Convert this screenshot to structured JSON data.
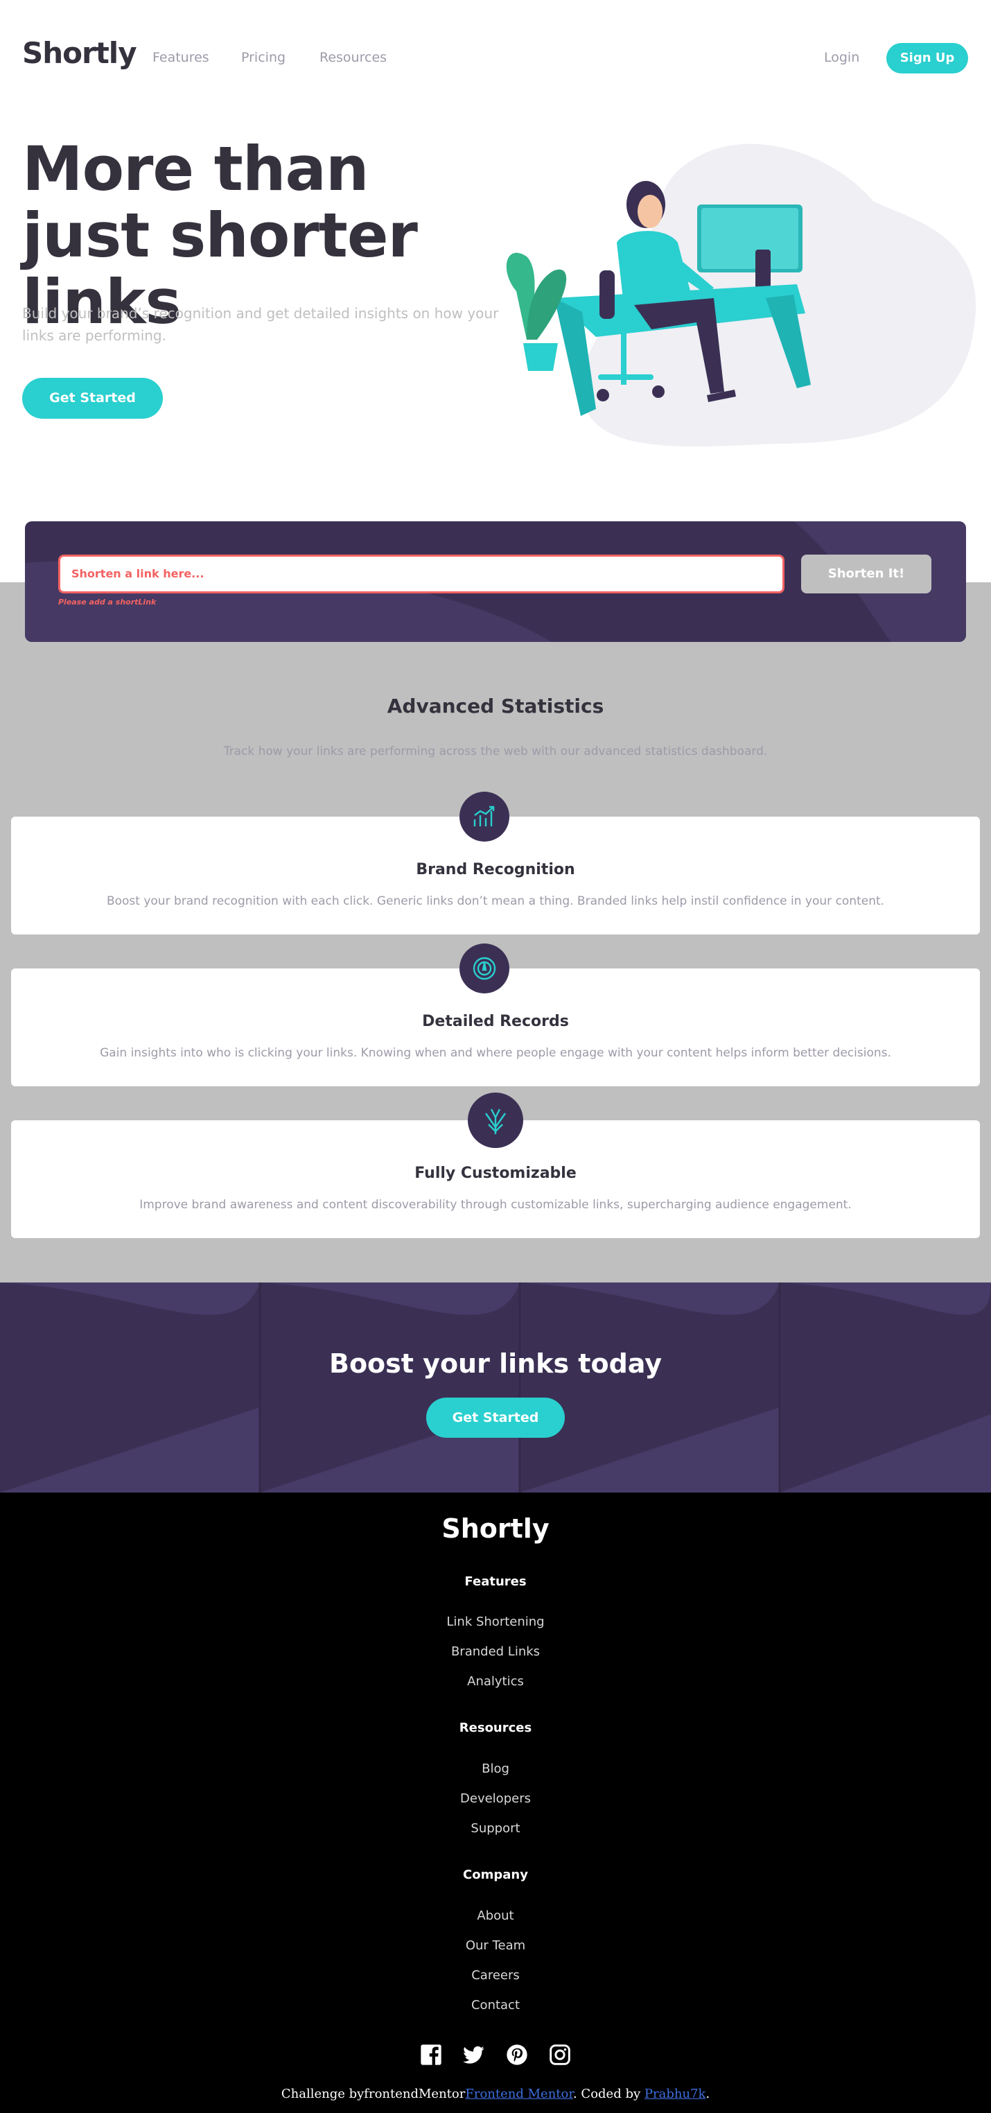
{
  "nav": {
    "logo": "Shortly",
    "links": [
      "Features",
      "Pricing",
      "Resources"
    ],
    "login": "Login",
    "signup": "Sign Up"
  },
  "hero": {
    "title": "More than just shorter links",
    "subtitle": "Build your brand’s recognition and get detailed insights on how your links are performing.",
    "cta": "Get Started",
    "illustration": "person-working-at-desk-illustration"
  },
  "shorten": {
    "placeholder": "Shorten a link here...",
    "error": "Please add a shortLink",
    "button": "Shorten It!"
  },
  "stats": {
    "title": "Advanced Statistics",
    "subtitle": "Track how your links are performing across the web with our advanced statistics dashboard.",
    "cards": [
      {
        "icon": "brand-recognition-icon",
        "title": "Brand Recognition",
        "text": "Boost your brand recognition with each click. Generic links don’t mean a thing. Branded links help instil confidence in your content."
      },
      {
        "icon": "detailed-records-icon",
        "title": "Detailed Records",
        "text": "Gain insights into who is clicking your links. Knowing when and where people engage with your content helps inform better decisions."
      },
      {
        "icon": "fully-customizable-icon",
        "title": "Fully Customizable",
        "text": "Improve brand awareness and content discoverability through customizable links, supercharging audience engagement."
      }
    ]
  },
  "boost": {
    "title": "Boost your links today",
    "cta": "Get Started"
  },
  "footer": {
    "logo": "Shortly",
    "columns": [
      {
        "heading": "Features",
        "links": [
          "Link Shortening",
          "Branded Links",
          "Analytics"
        ]
      },
      {
        "heading": "Resources",
        "links": [
          "Blog",
          "Developers",
          "Support"
        ]
      },
      {
        "heading": "Company",
        "links": [
          "About",
          "Our Team",
          "Careers",
          "Contact"
        ]
      }
    ],
    "socials": [
      "facebook-icon",
      "twitter-icon",
      "pinterest-icon",
      "instagram-icon"
    ],
    "credit": {
      "prefix": "Challenge byfrontendMentor",
      "fm_link": "Frontend Mentor",
      "middle": ". Coded by ",
      "author_link": "Prabhu7k",
      "suffix": "."
    }
  },
  "colors": {
    "cyan": "#2acfcf",
    "dark_violet": "#3b3054",
    "error_red": "#f46262",
    "gray": "#bfbfbf",
    "text_dark": "#35323e",
    "text_gray": "#9e9aa8"
  }
}
